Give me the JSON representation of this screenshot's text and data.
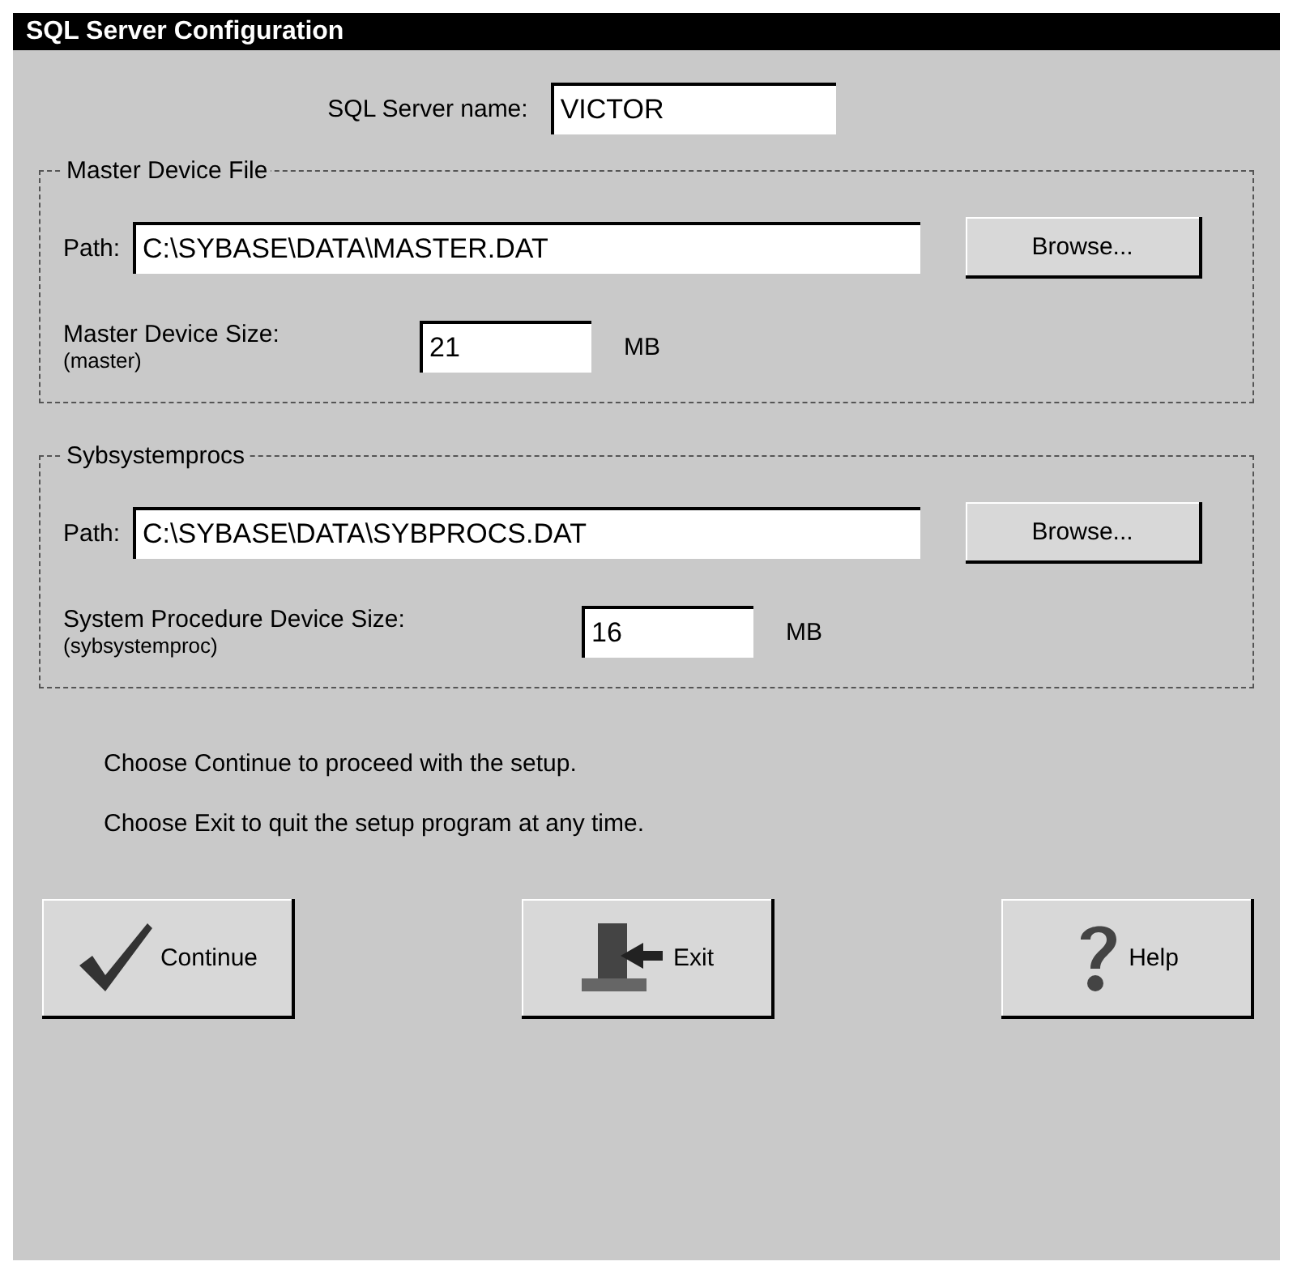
{
  "window": {
    "title": "SQL Server Configuration"
  },
  "server_name": {
    "label": "SQL Server name:",
    "value": "VICTOR"
  },
  "groups": [
    {
      "title": "Master Device File",
      "path_label": "Path:",
      "path": "C:\\SYBASE\\DATA\\MASTER.DAT",
      "browse": "Browse...",
      "size_label": "Master Device Size:",
      "size_sub": "(master)",
      "size": "21",
      "unit": "MB"
    },
    {
      "title": "Sybsystemprocs",
      "path_label": "Path:",
      "path": "C:\\SYBASE\\DATA\\SYBPROCS.DAT",
      "browse": "Browse...",
      "size_label": "System Procedure Device Size:",
      "size_sub": "(sybsystemproc)",
      "size": "16",
      "unit": "MB"
    }
  ],
  "instructions": [
    "Choose Continue to proceed with the setup.",
    "Choose Exit to quit the setup program at any time."
  ],
  "buttons": [
    {
      "kind": "continue",
      "label": "Continue"
    },
    {
      "kind": "exit",
      "label": "Exit"
    },
    {
      "kind": "help",
      "label": "Help"
    }
  ]
}
